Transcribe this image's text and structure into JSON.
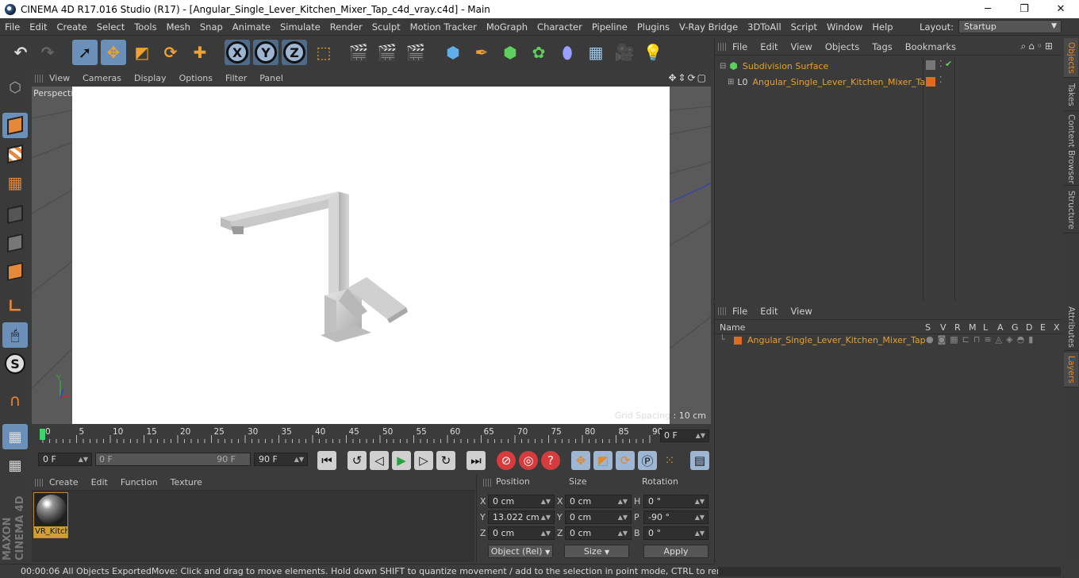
{
  "window": {
    "title": "CINEMA 4D R17.016 Studio (R17) - [Angular_Single_Lever_Kitchen_Mixer_Tap_c4d_vray.c4d] - Main",
    "minimize": "─",
    "maximize": "❐",
    "close": "✕"
  },
  "menubar": {
    "items": [
      "File",
      "Edit",
      "Create",
      "Select",
      "Tools",
      "Mesh",
      "Snap",
      "Animate",
      "Simulate",
      "Render",
      "Sculpt",
      "Motion Tracker",
      "MoGraph",
      "Character",
      "Pipeline",
      "Plugins",
      "V-Ray Bridge",
      "3DToAll",
      "Script",
      "Window",
      "Help"
    ],
    "layout_label": "Layout:",
    "layout_value": "Startup"
  },
  "toolbar": {
    "axis_x": "X",
    "axis_y": "Y",
    "axis_z": "Z"
  },
  "viewport": {
    "menu": [
      "View",
      "Cameras",
      "Display",
      "Options",
      "Filter",
      "Panel"
    ],
    "camera_label": "Perspective",
    "grid_spacing": "Grid Spacing : 10 cm",
    "axis_y_label": "Y"
  },
  "timeline": {
    "ticks": [
      "0",
      "5",
      "10",
      "15",
      "20",
      "25",
      "30",
      "35",
      "40",
      "45",
      "50",
      "55",
      "60",
      "65",
      "70",
      "75",
      "80",
      "85",
      "90"
    ],
    "current_frame": "0 F"
  },
  "transport": {
    "start_frame": "0 F",
    "range_start": "0 F",
    "range_end": "90 F",
    "end_frame": "90 F"
  },
  "material_manager": {
    "menu": [
      "Create",
      "Edit",
      "Function",
      "Texture"
    ],
    "material_name": "VR_Kitch"
  },
  "coordinates": {
    "headers": {
      "position": "Position",
      "size": "Size",
      "rotation": "Rotation"
    },
    "rows": [
      {
        "axis": "X",
        "position": "0 cm",
        "size_axis": "X",
        "size": "0 cm",
        "rot_axis": "H",
        "rotation": "0 °"
      },
      {
        "axis": "Y",
        "position": "13.022 cm",
        "size_axis": "Y",
        "size": "0 cm",
        "rot_axis": "P",
        "rotation": "-90 °"
      },
      {
        "axis": "Z",
        "position": "0 cm",
        "size_axis": "Z",
        "size": "0 cm",
        "rot_axis": "B",
        "rotation": "0 °"
      }
    ],
    "mode": "Object (Rel)",
    "size_mode": "Size",
    "apply": "Apply"
  },
  "statusbar": {
    "time": "00:00:06 All Objects Exported",
    "hint": "Move: Click and drag to move elements. Hold down SHIFT to quantize movement / add to the selection in point mode, CTRL to remove."
  },
  "object_manager": {
    "menu": [
      "File",
      "Edit",
      "View",
      "Objects",
      "Tags",
      "Bookmarks"
    ],
    "objects": [
      {
        "name": "Subdivision Surface"
      },
      {
        "name": "Angular_Single_Lever_Kitchen_Mixer_Tap"
      }
    ]
  },
  "layer_manager": {
    "menu": [
      "File",
      "Edit",
      "View"
    ],
    "columns": [
      "Name",
      "S",
      "V",
      "R",
      "M",
      "L",
      "A",
      "G",
      "D",
      "E",
      "X"
    ],
    "layers": [
      {
        "name": "Angular_Single_Lever_Kitchen_Mixer_Tap",
        "color": "#e06a20"
      }
    ]
  },
  "side_tabs": [
    "Objects",
    "Takes",
    "Content Browser",
    "Structure",
    "Attributes",
    "Layers"
  ],
  "brand": {
    "maxon": "MAXON",
    "product": "CINEMA 4D"
  }
}
